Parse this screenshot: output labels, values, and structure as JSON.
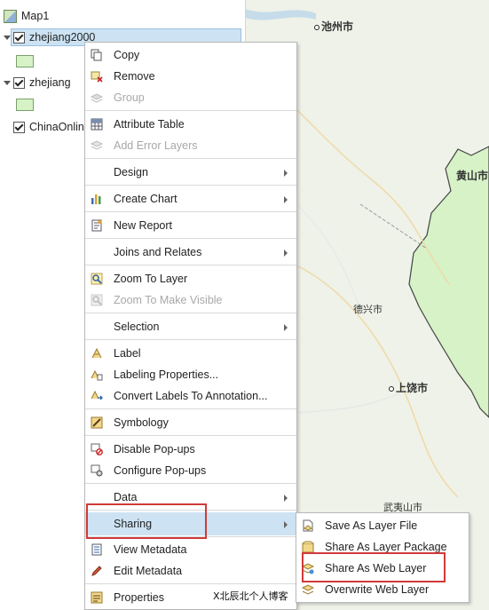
{
  "map_labels": [
    {
      "text": "池州市",
      "big": true
    },
    {
      "text": "黄山市",
      "big": true
    },
    {
      "text": "德兴市",
      "big": false
    },
    {
      "text": "上饶市",
      "big": true
    },
    {
      "text": "武夷山市",
      "big": false
    }
  ],
  "toc": {
    "map_name": "Map1",
    "layers": [
      {
        "name": "zhejiang2000"
      },
      {
        "name": "zhejiang"
      },
      {
        "name": "ChinaOnlin"
      }
    ]
  },
  "menu": {
    "copy": "Copy",
    "remove": "Remove",
    "group": "Group",
    "attribute_table": "Attribute Table",
    "add_error_layers": "Add Error Layers",
    "design": "Design",
    "create_chart": "Create Chart",
    "new_report": "New Report",
    "joins_relates": "Joins and Relates",
    "zoom_to_layer": "Zoom To Layer",
    "zoom_to_visible": "Zoom To Make Visible",
    "selection": "Selection",
    "label": "Label",
    "labeling_properties": "Labeling Properties...",
    "convert_labels": "Convert Labels To Annotation...",
    "symbology": "Symbology",
    "disable_popups": "Disable Pop-ups",
    "configure_popups": "Configure Pop-ups",
    "data": "Data",
    "sharing": "Sharing",
    "view_metadata": "View Metadata",
    "edit_metadata": "Edit Metadata",
    "properties": "Properties"
  },
  "submenu": {
    "save_layer_file": "Save As Layer File",
    "share_layer_package": "Share As Layer Package",
    "share_web_layer": "Share As Web Layer",
    "overwrite_web_layer": "Overwrite Web Layer"
  },
  "watermark": "X北辰北个人博客",
  "colors": {
    "highlight": "#cde3f3",
    "annotation_red": "#d03a3a",
    "map_bg": "#eef2e8",
    "polygon": "#d6f2c6"
  }
}
